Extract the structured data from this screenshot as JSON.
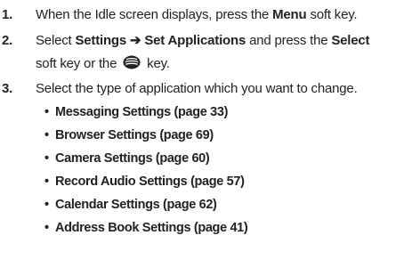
{
  "steps": [
    {
      "number": "1.",
      "pre": "When the Idle screen displays, press the ",
      "bold": "Menu",
      "post": " soft key."
    },
    {
      "number": "2.",
      "pre": "Select ",
      "bold1": "Settings ➔ Set Applications",
      "mid": " and press the ",
      "bold2": "Select",
      "line2_pre": "soft key or the ",
      "key_icon": "select-key-icon",
      "line2_post": " key."
    },
    {
      "number": "3.",
      "text": "Select the type of application which you want to change."
    }
  ],
  "bullets": [
    "Messaging Settings (page 33)",
    "Browser Settings (page 69)",
    "Camera Settings (page 60)",
    "Record Audio Settings (page 57)",
    "Calendar Settings (page 62)",
    "Address Book Settings (page 41)"
  ],
  "bullet_char": "•"
}
